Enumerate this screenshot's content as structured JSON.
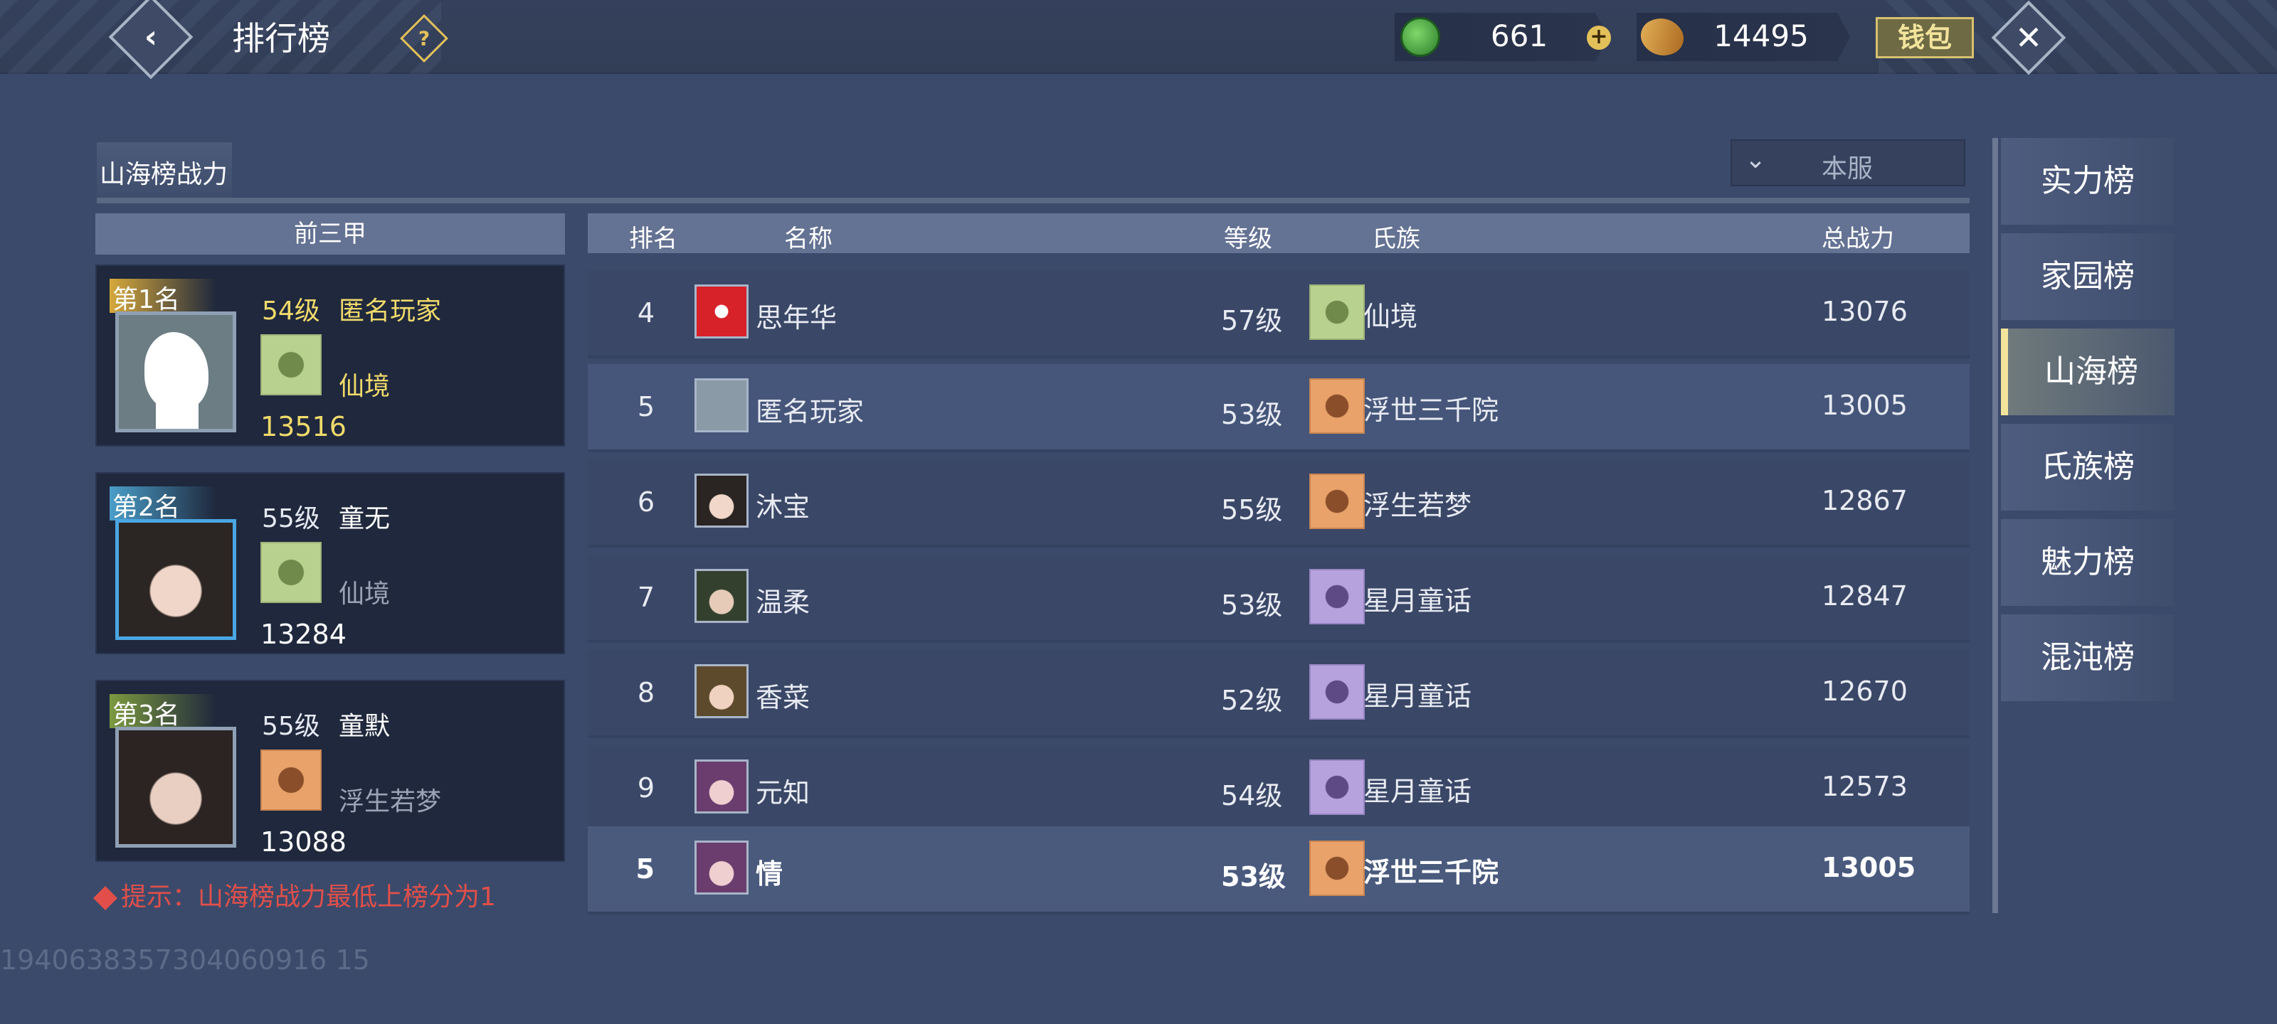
{
  "header": {
    "title": "排行榜",
    "back_icon": "‹",
    "help_icon": "?",
    "currency_jade": "661",
    "currency_coin": "14495",
    "plus_icon": "+",
    "wallet_label": "钱包",
    "close_icon": "✕"
  },
  "board": {
    "subtab": "山海榜战力",
    "filter_label": "本服",
    "filter_chevron": "⌄",
    "top3_title": "前三甲",
    "hint": "提示：山海榜战力最低上榜分为1",
    "uid": "1940638357304060916 15"
  },
  "top3": [
    {
      "rank": "第1名",
      "level": "54级",
      "name": "匿名玩家",
      "clan": "仙境",
      "power": "13516"
    },
    {
      "rank": "第2名",
      "level": "55级",
      "name": "童无",
      "clan": "仙境",
      "power": "13284"
    },
    {
      "rank": "第3名",
      "level": "55级",
      "name": "童默",
      "clan": "浮生若梦",
      "power": "13088"
    }
  ],
  "table": {
    "headers": {
      "rank": "排名",
      "name": "名称",
      "level": "等级",
      "clan": "氏族",
      "power": "总战力"
    },
    "rows": [
      {
        "rank": "4",
        "name": "思年华",
        "level": "57级",
        "clan": "仙境",
        "power": "13076"
      },
      {
        "rank": "5",
        "name": "匿名玩家",
        "level": "53级",
        "clan": "浮世三千院",
        "power": "13005"
      },
      {
        "rank": "6",
        "name": "沐宝",
        "level": "55级",
        "clan": "浮生若梦",
        "power": "12867"
      },
      {
        "rank": "7",
        "name": "温柔",
        "level": "53级",
        "clan": "星月童话",
        "power": "12847"
      },
      {
        "rank": "8",
        "name": "香菜",
        "level": "52级",
        "clan": "星月童话",
        "power": "12670"
      },
      {
        "rank": "9",
        "name": "元知",
        "level": "54级",
        "clan": "星月童话",
        "power": "12573"
      }
    ],
    "my_row": {
      "rank": "5",
      "name": "情",
      "level": "53级",
      "clan": "浮世三千院",
      "power": "13005"
    }
  },
  "nav": [
    {
      "label": "实力榜",
      "active": false
    },
    {
      "label": "家园榜",
      "active": false
    },
    {
      "label": "山海榜",
      "active": true
    },
    {
      "label": "氏族榜",
      "active": false
    },
    {
      "label": "魅力榜",
      "active": false
    },
    {
      "label": "混沌榜",
      "active": false
    }
  ],
  "colors": {
    "background": "#3b4a6b",
    "accent_gold": "#f0da6b",
    "hint_red": "#e24f4a",
    "header_bar": "#647293"
  }
}
